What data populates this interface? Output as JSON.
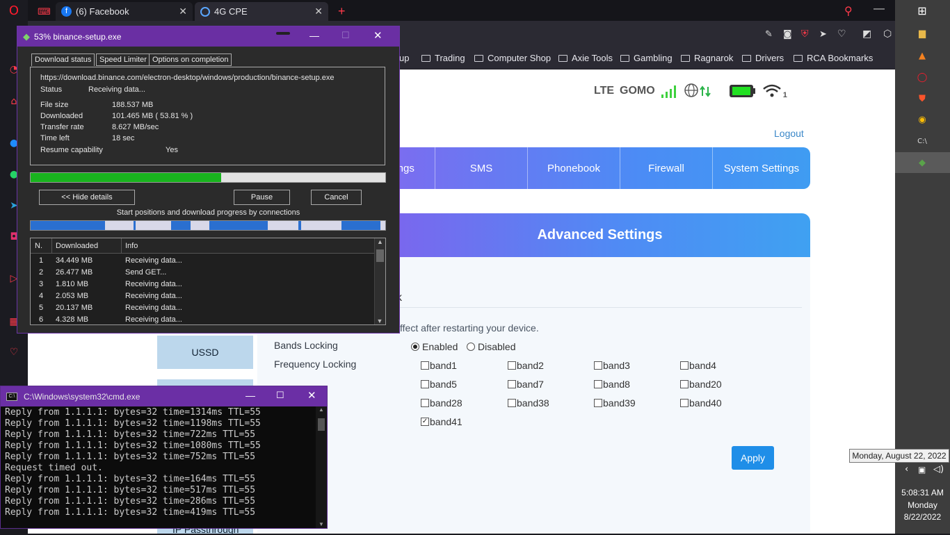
{
  "browser": {
    "tabs": [
      {
        "label": "(6) Facebook"
      },
      {
        "label": "4G CPE"
      }
    ],
    "bookmarks": [
      "up",
      "Trading",
      "Computer Shop",
      "Axie Tools",
      "Gambling",
      "Ragnarok",
      "Drivers",
      "RCA Bookmarks"
    ]
  },
  "router": {
    "network_type": "LTE",
    "carrier": "GOMO",
    "wifi_clients": "1",
    "logout": "Logout",
    "nav": [
      "ttings",
      "SMS",
      "Phonebook",
      "Firewall",
      "System Settings"
    ],
    "section_title": "Advanced Settings",
    "partial_heading": "k",
    "notice": "ffect after restarting your device.",
    "left_menu": {
      "ussd": "USSD",
      "ip_passthrough": "IP Passthrough"
    },
    "bands_locking_label": "Bands Locking",
    "frequency_locking_label": "Frequency Locking",
    "enabled_label": "Enabled",
    "disabled_label": "Disabled",
    "bands_locking_selected": "Enabled",
    "bands": [
      {
        "name": "band1",
        "checked": false
      },
      {
        "name": "band2",
        "checked": false
      },
      {
        "name": "band3",
        "checked": false
      },
      {
        "name": "band4",
        "checked": false
      },
      {
        "name": "band5",
        "checked": false
      },
      {
        "name": "band7",
        "checked": false
      },
      {
        "name": "band8",
        "checked": false
      },
      {
        "name": "band20",
        "checked": false
      },
      {
        "name": "band28",
        "checked": false
      },
      {
        "name": "band38",
        "checked": false
      },
      {
        "name": "band39",
        "checked": false
      },
      {
        "name": "band40",
        "checked": false
      },
      {
        "name": "band41",
        "checked": true
      }
    ],
    "apply": "Apply"
  },
  "idm": {
    "title": "53% binance-setup.exe",
    "tabs": [
      "Download status",
      "Speed Limiter",
      "Options on completion"
    ],
    "url": "https://download.binance.com/electron-desktop/windows/production/binance-setup.exe",
    "status_label": "Status",
    "status_value": "Receiving data...",
    "file_size_label": "File size",
    "file_size": "188.537  MB",
    "downloaded_label": "Downloaded",
    "downloaded": "101.465  MB  ( 53.81 % )",
    "transfer_rate_label": "Transfer rate",
    "transfer_rate": "8.627  MB/sec",
    "time_left_label": "Time left",
    "time_left": "18 sec",
    "resume_label": "Resume capability",
    "resume_value": "Yes",
    "progress": 0.5381,
    "hide_details": "<< Hide details",
    "pause": "Pause",
    "cancel": "Cancel",
    "connections_caption": "Start positions and download progress by connections",
    "columns": [
      "N.",
      "Downloaded",
      "Info"
    ],
    "connections": [
      {
        "n": "1",
        "downloaded": "34.449  MB",
        "info": "Receiving data..."
      },
      {
        "n": "2",
        "downloaded": "26.477  MB",
        "info": "Send GET..."
      },
      {
        "n": "3",
        "downloaded": "1.810  MB",
        "info": "Receiving data..."
      },
      {
        "n": "4",
        "downloaded": "2.053  MB",
        "info": "Receiving data..."
      },
      {
        "n": "5",
        "downloaded": "20.137  MB",
        "info": "Receiving data..."
      },
      {
        "n": "6",
        "downloaded": "4.328  MB",
        "info": "Receiving data..."
      }
    ]
  },
  "cmd": {
    "title": "C:\\Windows\\system32\\cmd.exe",
    "lines": [
      "Reply from 1.1.1.1: bytes=32 time=1314ms TTL=55",
      "Reply from 1.1.1.1: bytes=32 time=1198ms TTL=55",
      "Reply from 1.1.1.1: bytes=32 time=722ms TTL=55",
      "Reply from 1.1.1.1: bytes=32 time=1080ms TTL=55",
      "Reply from 1.1.1.1: bytes=32 time=752ms TTL=55",
      "Request timed out.",
      "Reply from 1.1.1.1: bytes=32 time=164ms TTL=55",
      "Reply from 1.1.1.1: bytes=32 time=517ms TTL=55",
      "Reply from 1.1.1.1: bytes=32 time=286ms TTL=55",
      "Reply from 1.1.1.1: bytes=32 time=419ms TTL=55"
    ]
  },
  "taskbar": {
    "tooltip": "Monday, August 22, 2022",
    "time": "5:08:31 AM",
    "day": "Monday",
    "date": "8/22/2022"
  },
  "colors": {
    "accent_purple": "#6a2fa3",
    "progress_green": "#19b41e",
    "router_blue": "#4b8cf5",
    "apply_blue": "#1f8ee8"
  }
}
